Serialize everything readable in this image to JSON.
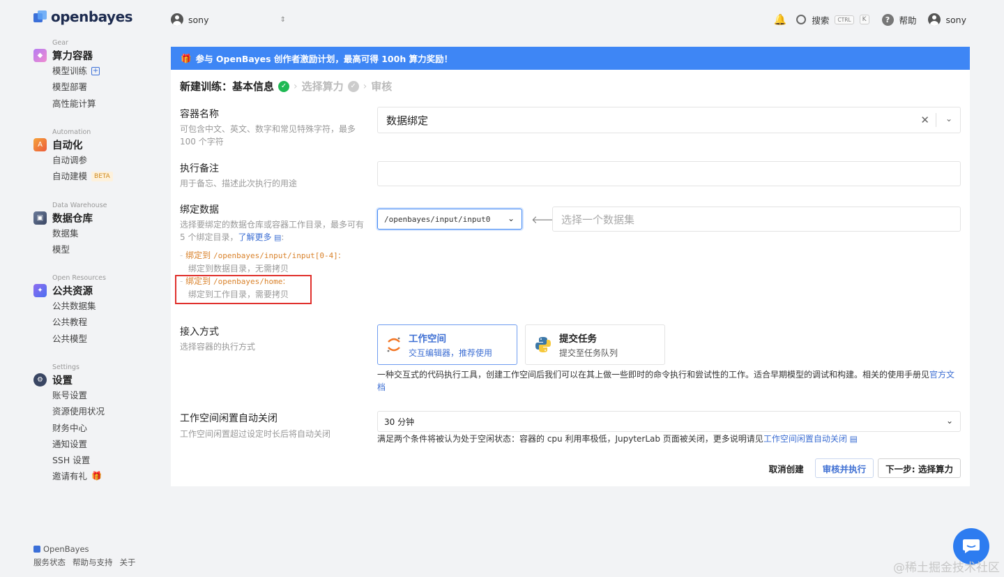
{
  "app": {
    "brand": "openbayes"
  },
  "sidebar": {
    "sections": [
      {
        "caption": "Gear",
        "title": "算力容器",
        "items": [
          "模型训练",
          "模型部署",
          "高性能计算"
        ]
      },
      {
        "caption": "Automation",
        "title": "自动化",
        "items": [
          "自动调参",
          "自动建模"
        ],
        "badge": "BETA"
      },
      {
        "caption": "Data Warehouse",
        "title": "数据仓库",
        "items": [
          "数据集",
          "模型"
        ]
      },
      {
        "caption": "Open Resources",
        "title": "公共资源",
        "items": [
          "公共数据集",
          "公共教程",
          "公共模型"
        ]
      },
      {
        "caption": "Settings",
        "title": "设置",
        "items": [
          "账号设置",
          "资源使用状况",
          "财务中心",
          "通知设置",
          "SSH 设置",
          "邀请有礼"
        ]
      }
    ],
    "footer": {
      "brand": "OpenBayes",
      "links": [
        "服务状态",
        "帮助与支持",
        "关于"
      ]
    }
  },
  "topbar": {
    "workspace_user": "sony",
    "search_label": "搜索",
    "kbd_ctrl": "CTRL",
    "kbd_k": "K",
    "help_label": "帮助",
    "user_name": "sony"
  },
  "banner": {
    "text": "参与 OpenBayes 创作者激励计划，最高可得 100h 算力奖励！"
  },
  "steps": {
    "current": "新建训练：基本信息",
    "step2": "选择算力",
    "step3": "审核"
  },
  "form": {
    "name": {
      "label": "容器名称",
      "desc": "可包含中文、英文、数字和常见特殊字符，最多 100 个字符",
      "value": "数据绑定"
    },
    "note": {
      "label": "执行备注",
      "desc": "用于备忘、描述此次执行的用途",
      "value": ""
    },
    "bind": {
      "label": "绑定数据",
      "desc": "选择要绑定的数据仓库或容器工作目录，最多可有 5 个绑定目录，",
      "learn_more": "了解更多",
      "rule1_prefix": "绑定到",
      "rule1_path": "/openbayes/input/input[0-4]",
      "rule1_desc": "绑定到数据目录，无需拷贝",
      "rule2_prefix": "绑定到",
      "rule2_path": "/openbayes/home",
      "rule2_desc": "绑定到工作目录，需要拷贝",
      "path_value": "/openbayes/input/input0",
      "dataset_placeholder": "选择一个数据集"
    },
    "access": {
      "label": "接入方式",
      "desc": "选择容器的执行方式",
      "mode1_title": "工作空间",
      "mode1_sub": "交互编辑器，推荐使用",
      "mode2_title": "提交任务",
      "mode2_sub": "提交至任务队列",
      "explain": "一种交互式的代码执行工具，创建工作空间后我们可以在其上做一些即时的命令执行和尝试性的工作。适合早期模型的调试和构建。相关的使用手册见",
      "explain_link": "官方文档"
    },
    "idle": {
      "label": "工作空间闲置自动关闭",
      "desc": "工作空间闲置超过设定时长后将自动关闭",
      "value": "30 分钟",
      "explain": "满足两个条件将被认为处于空闲状态：容器的 cpu 利用率极低，JupyterLab 页面被关闭，更多说明请见",
      "explain_link": "工作空间闲置自动关闭"
    }
  },
  "actions": {
    "cancel": "取消创建",
    "review": "审核并执行",
    "next": "下一步: 选择算力"
  },
  "watermark": "@稀土掘金技术社区",
  "colors": {
    "primary": "#3e86f5",
    "link": "#3e6fd3",
    "success": "#1fb954",
    "highlight": "#e0302c"
  }
}
